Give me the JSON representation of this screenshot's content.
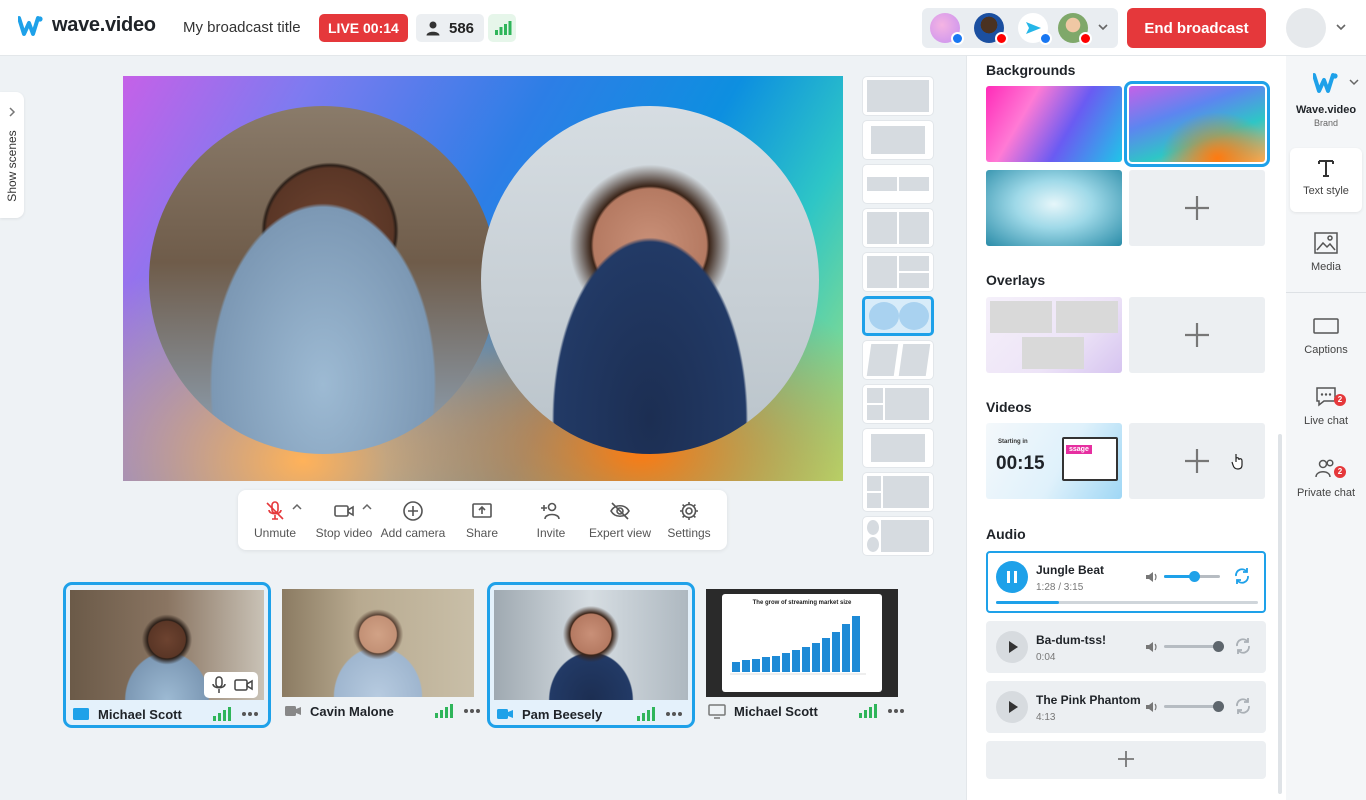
{
  "header": {
    "brand": "wave.video",
    "broadcast_title": "My broadcast title",
    "live_label": "LIVE 00:14",
    "viewer_count": "586",
    "end_broadcast_label": "End broadcast"
  },
  "sidebar_left": {
    "show_scenes_label": "Show scenes"
  },
  "controls": {
    "unmute": "Unmute",
    "stop_video": "Stop video",
    "add_camera": "Add camera",
    "share": "Share",
    "invite": "Invite",
    "expert_view": "Expert view",
    "settings": "Settings"
  },
  "participants": [
    {
      "name": "Michael Scott",
      "source": "camera",
      "selected": true
    },
    {
      "name": "Cavin Malone",
      "source": "camera",
      "selected": false
    },
    {
      "name": "Pam Beesely",
      "source": "camera",
      "selected": true
    },
    {
      "name": "Michael Scott",
      "source": "screen",
      "selected": false
    }
  ],
  "screen_share": {
    "slide_title": "The grow of streaming market size"
  },
  "panel": {
    "backgrounds_title": "Backgrounds",
    "overlays_title": "Overlays",
    "videos_title": "Videos",
    "audio_title": "Audio",
    "video_thumb": {
      "label": "Starting in",
      "countdown": "00:15",
      "screen_text": "ssage"
    }
  },
  "audio_tracks": [
    {
      "name": "Jungle Beat",
      "time": "1:28 / 3:15",
      "state": "playing",
      "volume": 0.55,
      "progress": 0.24
    },
    {
      "name": "Ba-dum-tss!",
      "time": "0:04",
      "state": "paused",
      "volume": 0.95
    },
    {
      "name": "The Pink Phantom",
      "time": "4:13",
      "state": "paused",
      "volume": 0.95
    }
  ],
  "tools": {
    "brand_label": "Wave.video",
    "brand_sub": "Brand",
    "text_style": "Text style",
    "media": "Media",
    "captions": "Captions",
    "live_chat": "Live chat",
    "live_chat_badge": "2",
    "private_chat": "Private chat",
    "private_chat_badge": "2"
  },
  "colors": {
    "accent": "#1ea1e9",
    "live_red": "#e5383b",
    "signal_green": "#2fb55a"
  }
}
